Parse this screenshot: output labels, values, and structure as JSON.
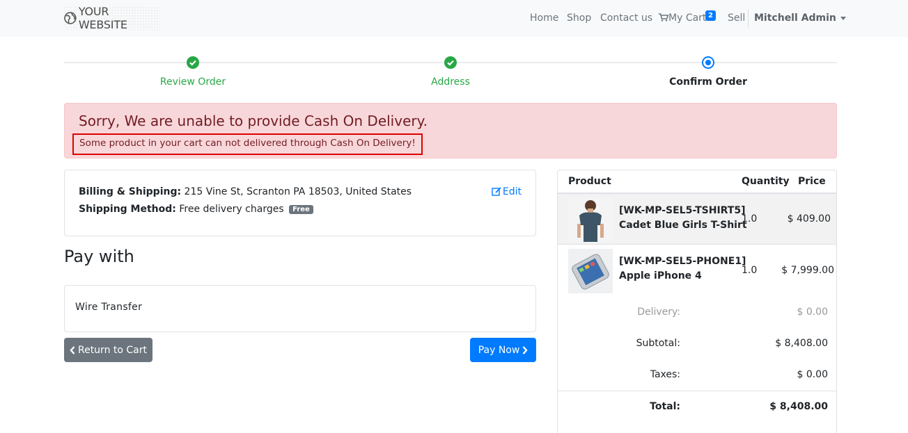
{
  "navbar": {
    "brand": "YOUR WEBSITE",
    "links": [
      "Home",
      "Shop",
      "Contact us"
    ],
    "cart_label": "My Cart",
    "cart_count": "2",
    "sell": "Sell",
    "user": "Mitchell Admin"
  },
  "wizard": {
    "steps": [
      {
        "label": "Review Order",
        "state": "done"
      },
      {
        "label": "Address",
        "state": "done"
      },
      {
        "label": "Confirm Order",
        "state": "current"
      }
    ]
  },
  "alert": {
    "title": "Sorry, We are unable to provide Cash On Delivery.",
    "message": "Some product in your cart can not delivered through Cash On Delivery!"
  },
  "address": {
    "billing_label": "Billing & Shipping:",
    "billing_value": "215 Vine St, Scranton PA 18503, United States",
    "method_label": "Shipping Method:",
    "method_value": "Free delivery charges",
    "method_badge": "Free",
    "edit": "Edit"
  },
  "payment": {
    "heading": "Pay with",
    "option": "Wire Transfer",
    "return_button": "Return to Cart",
    "pay_button": "Pay Now"
  },
  "cart": {
    "headers": {
      "product": "Product",
      "quantity": "Quantity",
      "price": "Price"
    },
    "items": [
      {
        "code": "[WK-MP-SEL5-TSHIRT5]",
        "name": "Cadet Blue Girls T-Shirt",
        "qty": "1.0",
        "price": "$ 409.00"
      },
      {
        "code": "[WK-MP-SEL5-PHONE1]",
        "name": "Apple iPhone 4",
        "qty": "1.0",
        "price": "$ 7,999.00"
      }
    ],
    "delivery_label": "Delivery:",
    "delivery_value": "$ 0.00",
    "subtotal_label": "Subtotal:",
    "subtotal_value": "$ 8,408.00",
    "taxes_label": "Taxes:",
    "taxes_value": "$ 0.00",
    "total_label": "Total:",
    "total_value": "$ 8,408.00"
  },
  "colors": {
    "primary": "#007bff",
    "success": "#28a745",
    "danger_bg": "#f8d7da",
    "danger_text": "#721c24",
    "highlight_border": "#e00000",
    "secondary": "#6c757d"
  },
  "icons": [
    "globe-icon",
    "shopping-cart-icon",
    "check-circle-icon",
    "edit-icon",
    "chevron-left-icon",
    "chevron-right-icon"
  ]
}
